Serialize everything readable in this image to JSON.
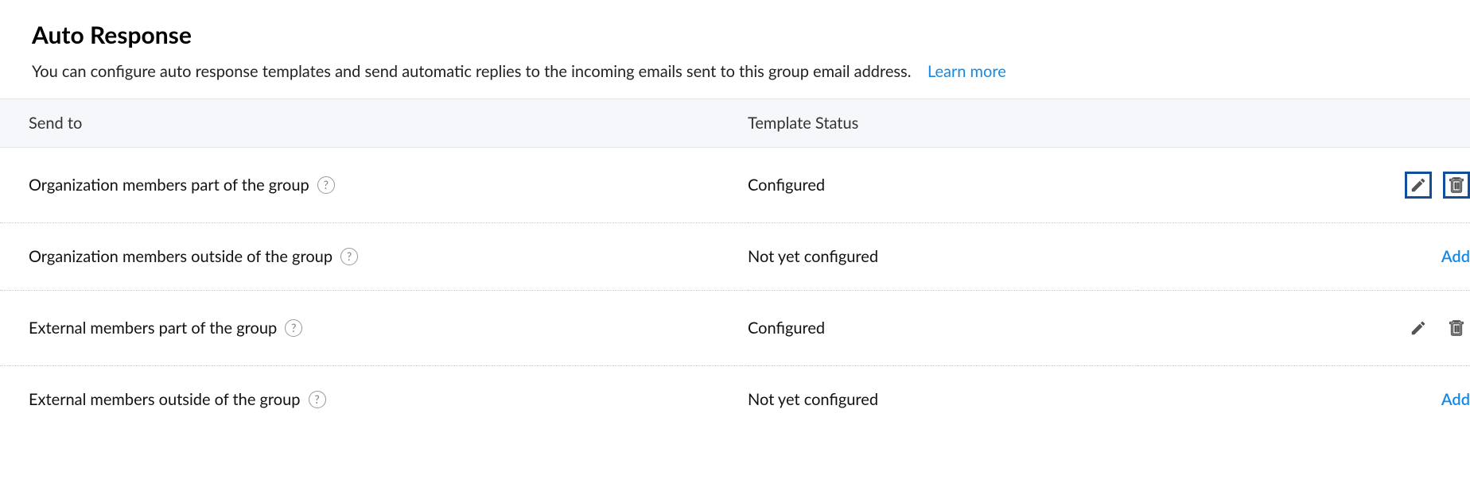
{
  "header": {
    "title": "Auto Response",
    "description": "You can configure auto response templates and send automatic replies to the incoming emails sent to this group email address.",
    "learn_more": "Learn more"
  },
  "table": {
    "columns": {
      "send_to": "Send to",
      "template_status": "Template Status"
    },
    "rows": [
      {
        "label": "Organization members part of the group",
        "status": "Configured",
        "action_type": "icons",
        "highlighted": true
      },
      {
        "label": "Organization members outside of the group",
        "status": "Not yet configured",
        "action_type": "add",
        "action_label": "Add"
      },
      {
        "label": "External members part of the group",
        "status": "Configured",
        "action_type": "icons",
        "highlighted": false
      },
      {
        "label": "External members outside of the group",
        "status": "Not yet configured",
        "action_type": "add",
        "action_label": "Add"
      }
    ]
  },
  "help_glyph": "?"
}
